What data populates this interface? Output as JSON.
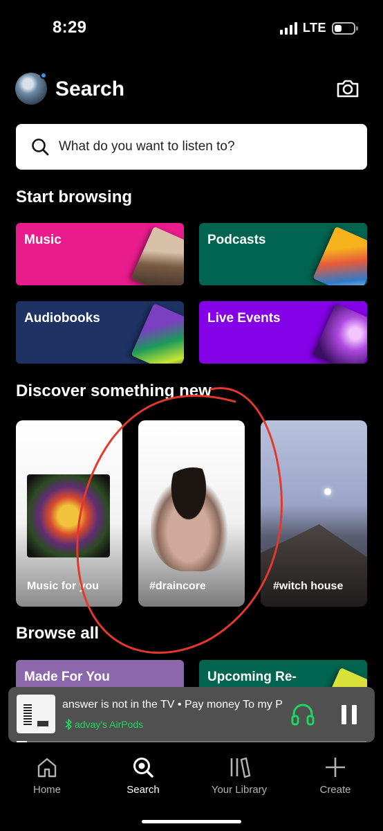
{
  "status_bar": {
    "time": "8:29",
    "network": "LTE"
  },
  "header": {
    "title": "Search"
  },
  "search": {
    "placeholder": "What do you want to listen to?"
  },
  "start_browsing": {
    "title": "Start browsing",
    "cards": [
      {
        "label": "Music",
        "color": "#e91c8c"
      },
      {
        "label": "Podcasts",
        "color": "#006450"
      },
      {
        "label": "Audiobooks",
        "color": "#1e3264"
      },
      {
        "label": "Live Events",
        "color": "#8400e7"
      }
    ]
  },
  "discover": {
    "title": "Discover something new",
    "cards": [
      {
        "label": "Music for you"
      },
      {
        "label": "#draincore"
      },
      {
        "label": "#witch house"
      }
    ]
  },
  "browse_all": {
    "title": "Browse all",
    "cards": [
      {
        "label": "Made For You",
        "color": "#8d67ab"
      },
      {
        "label": "Upcoming Re-",
        "color": "#006450"
      }
    ]
  },
  "player": {
    "title": "answer is not in the TV • Pay money To my P",
    "device": "advay's AirPods",
    "progress": 0.03,
    "accent_color": "#1ed760"
  },
  "tabs": [
    {
      "label": "Home",
      "icon": "home-icon"
    },
    {
      "label": "Search",
      "icon": "search-icon"
    },
    {
      "label": "Your Library",
      "icon": "library-icon"
    },
    {
      "label": "Create",
      "icon": "plus-icon"
    }
  ]
}
